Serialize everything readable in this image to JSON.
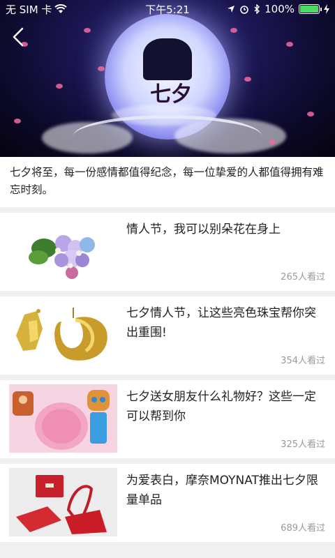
{
  "status": {
    "carrier": "无 SIM 卡",
    "time": "下午5:21",
    "battery": "100%"
  },
  "hero": {
    "overlay_text": "七夕"
  },
  "intro": "七夕将至，每一份感情都值得纪念，每一位挚爱的人都值得拥有难忘时刻。",
  "articles": [
    {
      "title": "情人节，我可以别朵花在身上",
      "views": "265人看过"
    },
    {
      "title": "七夕情人节，让这些亮色珠宝帮你突出重围!",
      "views": "354人看过"
    },
    {
      "title": "七夕送女朋友什么礼物好？这些一定可以帮到你",
      "views": "325人看过"
    },
    {
      "title": "为爱表白，摩奈MOYNAT推出七夕限量单品",
      "views": "689人看过"
    }
  ]
}
